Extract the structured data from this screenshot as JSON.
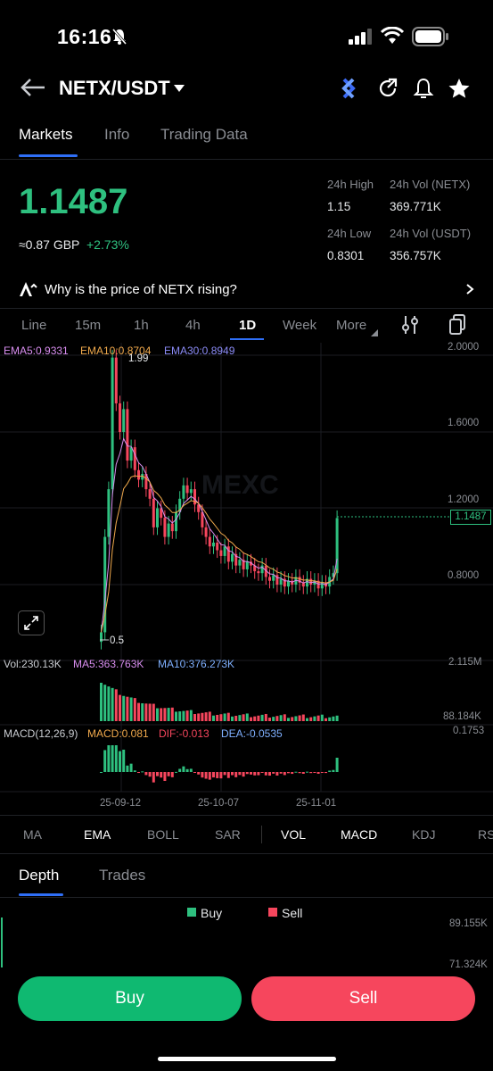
{
  "status_bar": {
    "time": "16:16"
  },
  "header": {
    "pair": "NETX/USDT"
  },
  "tabs": [
    "Markets",
    "Info",
    "Trading Data"
  ],
  "price": {
    "last": "1.1487",
    "fiat": "≈0.87 GBP",
    "change": "+2.73%"
  },
  "stats": {
    "high_label": "24h High",
    "high": "1.15",
    "vol_base_label": "24h Vol (NETX)",
    "vol_base": "369.771K",
    "low_label": "24h Low",
    "low": "0.8301",
    "vol_quote_label": "24h Vol (USDT)",
    "vol_quote": "356.757K"
  },
  "insight": {
    "text": "Why is the price of NETX rising?"
  },
  "timeframes": [
    "Line",
    "15m",
    "1h",
    "4h",
    "1D",
    "Week",
    "More"
  ],
  "chart": {
    "ema_legend": [
      "EMA5:0.9331",
      "EMA10:0.8704",
      "EMA30:0.8949"
    ],
    "y_ticks": [
      "2.0000",
      "1.6000",
      "1.2000",
      "0.8000"
    ],
    "current_price_tag": "1.1487",
    "high_marker": "1.99",
    "low_marker": "0.5",
    "watermark": "MEXC",
    "vol_legend": [
      "Vol:230.13K",
      "MA5:363.763K",
      "MA10:376.273K"
    ],
    "vol_ticks": [
      "2.115M",
      "88.184K"
    ],
    "macd_legend": [
      "MACD(12,26,9)",
      "MACD:0.081",
      "DIF:-0.013",
      "DEA:-0.0535"
    ],
    "macd_tick": "0.1753",
    "x_ticks": [
      "25-09-12",
      "25-10-07",
      "25-11-01"
    ]
  },
  "indicators": [
    "MA",
    "EMA",
    "BOLL",
    "SAR",
    "VOL",
    "MACD",
    "KDJ",
    "RS"
  ],
  "depth": {
    "tabs": [
      "Depth",
      "Trades"
    ],
    "legend_buy": "Buy",
    "legend_sell": "Sell",
    "y_ticks": [
      "89.155K",
      "71.324K"
    ]
  },
  "actions": {
    "buy": "Buy",
    "sell": "Sell"
  },
  "colors": {
    "up": "#2ec07f",
    "down": "#f6465d",
    "accent": "#2f6ff7",
    "ema5": "#d98ef0",
    "ema10": "#f0a94c",
    "ema30": "#6f6ff5"
  }
}
